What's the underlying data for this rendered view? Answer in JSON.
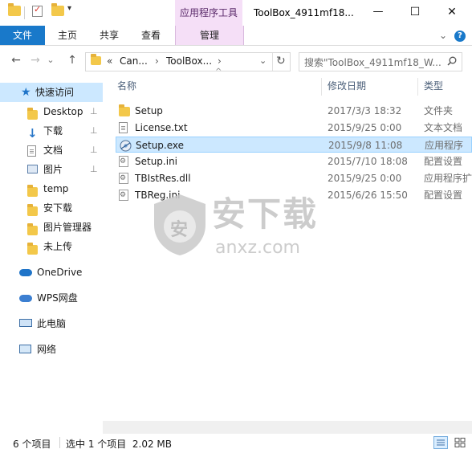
{
  "window": {
    "title": "ToolBox_4911mf18...",
    "context_tab_group": "应用程序工具",
    "minimize_glyph": "—",
    "maximize_glyph": "☐",
    "close_glyph": "✕"
  },
  "ribbon": {
    "tabs": [
      "文件",
      "主页",
      "共享",
      "查看",
      "管理"
    ],
    "expand_glyph": "⌄",
    "help_glyph": "?"
  },
  "address": {
    "back": "←",
    "forward": "→",
    "recent": "⌄",
    "up": "↑",
    "breadcrumb_overflow": "«",
    "breadcrumb": [
      "Can...",
      "ToolBox..."
    ],
    "separator": "›",
    "dropdown": "⌄",
    "refresh": "↻",
    "search_placeholder": "搜索\"ToolBox_4911mf18_W...",
    "search_icon": "magnifier-icon"
  },
  "nav": {
    "quick_access": "快速访问",
    "items": [
      {
        "label": "Desktop",
        "pinned": true,
        "icon": "folder-icon"
      },
      {
        "label": "下载",
        "pinned": true,
        "icon": "download-icon"
      },
      {
        "label": "文档",
        "pinned": true,
        "icon": "documents-icon"
      },
      {
        "label": "图片",
        "pinned": true,
        "icon": "pictures-icon"
      },
      {
        "label": "temp",
        "pinned": false,
        "icon": "folder-icon"
      },
      {
        "label": "安下载",
        "pinned": false,
        "icon": "folder-icon"
      },
      {
        "label": "图片管理器",
        "pinned": false,
        "icon": "folder-icon"
      },
      {
        "label": "未上传",
        "pinned": false,
        "icon": "folder-icon"
      }
    ],
    "pin_glyph": "📌",
    "onedrive": "OneDrive",
    "wps": "WPS网盘",
    "this_pc": "此电脑",
    "network": "网络"
  },
  "files": {
    "columns": {
      "name": "名称",
      "date": "修改日期",
      "type": "类型"
    },
    "sort_glyph": "^",
    "rows": [
      {
        "name": "Setup",
        "date": "2017/3/3 18:32",
        "type": "文件夹",
        "icon": "folder-icon",
        "selected": false
      },
      {
        "name": "License.txt",
        "date": "2015/9/25 0:00",
        "type": "文本文档",
        "icon": "text-file-icon",
        "selected": false
      },
      {
        "name": "Setup.exe",
        "date": "2015/9/8 11:08",
        "type": "应用程序",
        "icon": "installer-icon",
        "selected": true
      },
      {
        "name": "Setup.ini",
        "date": "2015/7/10 18:08",
        "type": "配置设置",
        "icon": "config-file-icon",
        "selected": false
      },
      {
        "name": "TBIstRes.dll",
        "date": "2015/9/25 0:00",
        "type": "应用程序扩",
        "icon": "dll-file-icon",
        "selected": false
      },
      {
        "name": "TBReg.ini",
        "date": "2015/6/26 15:50",
        "type": "配置设置",
        "icon": "config-file-icon",
        "selected": false
      }
    ]
  },
  "status": {
    "item_count": "6 个项目",
    "selection": "选中 1 个项目  2.02 MB"
  },
  "watermark": {
    "title": "安下载",
    "url": "anxz.com",
    "shield_char": "安"
  },
  "colors": {
    "file_tab": "#1979ca",
    "context_tab": "#f5dff7",
    "selection": "#cce8ff",
    "quick_access_bg": "#cce8ff"
  }
}
